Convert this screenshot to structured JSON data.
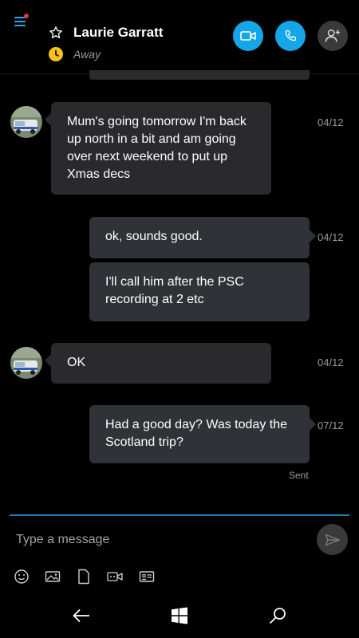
{
  "header": {
    "contact_name": "Laurie Garratt",
    "presence": "Away",
    "icons": {
      "menu": "hamburger-menu-icon",
      "favorite": "star-outline-icon",
      "presence": "clock-icon",
      "video": "video-camera-icon",
      "call": "phone-icon",
      "add_people": "add-person-icon"
    },
    "colors": {
      "accent": "#14a6e6",
      "presence_away": "#f7c31a",
      "notification_dot": "#e0333b"
    }
  },
  "messages": [
    {
      "direction": "incoming",
      "text": "Mum's going tomorrow I'm back up north in a bit and am going over next weekend to put up Xmas decs",
      "date": "04/12"
    },
    {
      "direction": "outgoing",
      "text": "ok, sounds good.",
      "date": "04/12"
    },
    {
      "direction": "outgoing",
      "text": "I'll call him after the PSC recording at 2 etc",
      "date": ""
    },
    {
      "direction": "incoming",
      "text": "OK",
      "date": "04/12"
    },
    {
      "direction": "outgoing",
      "text": "Had a good day? Was today the Scotland trip?",
      "date": "07/12",
      "status": "Sent"
    }
  ],
  "composer": {
    "placeholder": "Type a message",
    "tools": [
      "emoticon-icon",
      "image-icon",
      "file-icon",
      "video-message-icon",
      "contact-card-icon"
    ],
    "send_icon": "send-arrow-icon"
  },
  "navbar": {
    "icons": [
      "back-arrow-icon",
      "windows-logo-icon",
      "search-icon"
    ]
  }
}
